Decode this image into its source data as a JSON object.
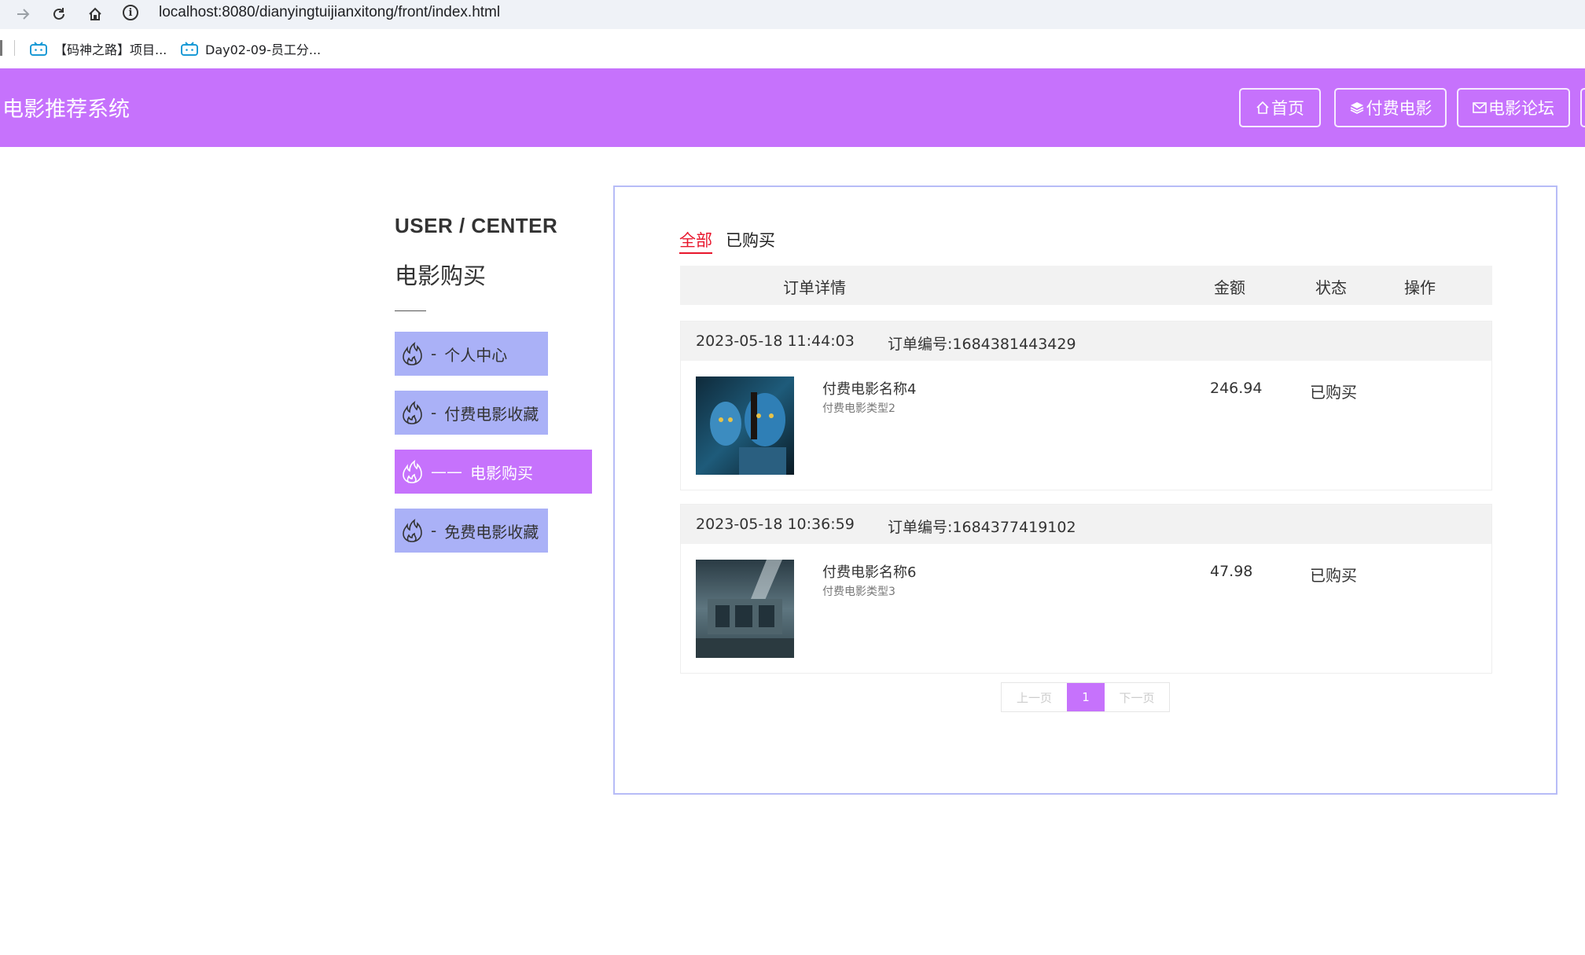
{
  "browser": {
    "url": "localhost:8080/dianyingtuijianxitong/front/index.html",
    "bookmarks": [
      "【码神之路】项目...",
      "Day02-09-员工分..."
    ]
  },
  "header": {
    "title": "电影推荐系统",
    "nav": [
      "首页",
      "付费电影",
      "电影论坛"
    ],
    "accent": "#c672fc"
  },
  "sidebar": {
    "title": "USER / CENTER",
    "subtitle": "电影购买",
    "items": [
      {
        "label": "个人中心",
        "prefix": "-"
      },
      {
        "label": "付费电影收藏",
        "prefix": "-"
      },
      {
        "label": "电影购买",
        "prefix": "——"
      },
      {
        "label": "免费电影收藏",
        "prefix": "-"
      }
    ],
    "item_color": "#aab1f7"
  },
  "tabs": [
    "全部",
    "已购买"
  ],
  "table": {
    "headers": [
      "订单详情",
      "金额",
      "状态",
      "操作"
    ]
  },
  "orders": [
    {
      "datetime": "2023-05-18 11:44:03",
      "order_no": "订单编号:1684381443429",
      "name": "付费电影名称4",
      "type": "付费电影类型2",
      "price": "246.94",
      "status": "已购买"
    },
    {
      "datetime": "2023-05-18 10:36:59",
      "order_no": "订单编号:1684377419102",
      "name": "付费电影名称6",
      "type": "付费电影类型3",
      "price": "47.98",
      "status": "已购买"
    }
  ],
  "pager": {
    "prev": "上一页",
    "current": "1",
    "next": "下一页"
  }
}
